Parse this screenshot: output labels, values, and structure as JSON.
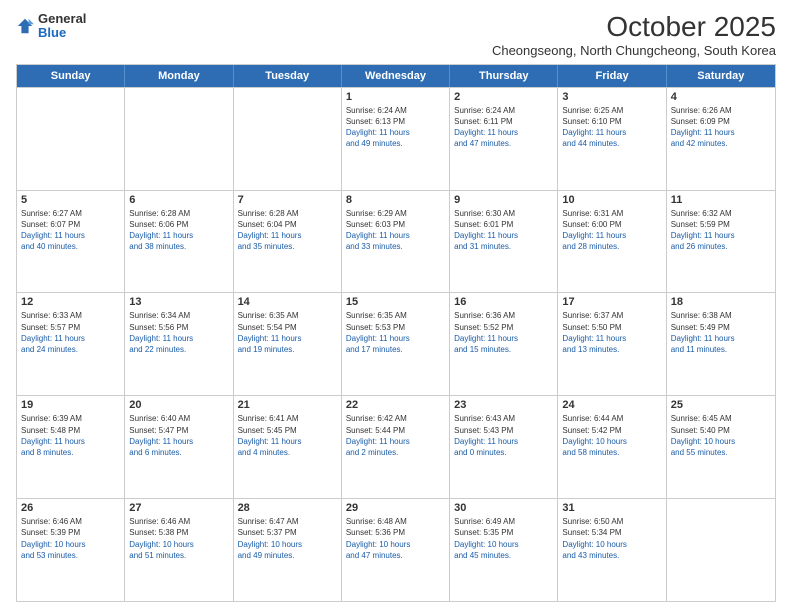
{
  "logo": {
    "general": "General",
    "blue": "Blue"
  },
  "header": {
    "month": "October 2025",
    "subtitle": "Cheongseong, North Chungcheong, South Korea"
  },
  "weekdays": [
    "Sunday",
    "Monday",
    "Tuesday",
    "Wednesday",
    "Thursday",
    "Friday",
    "Saturday"
  ],
  "weeks": [
    [
      {
        "day": "",
        "info": ""
      },
      {
        "day": "",
        "info": ""
      },
      {
        "day": "",
        "info": ""
      },
      {
        "day": "1",
        "info": "Sunrise: 6:24 AM\nSunset: 6:13 PM\nDaylight: 11 hours\nand 49 minutes."
      },
      {
        "day": "2",
        "info": "Sunrise: 6:24 AM\nSunset: 6:11 PM\nDaylight: 11 hours\nand 47 minutes."
      },
      {
        "day": "3",
        "info": "Sunrise: 6:25 AM\nSunset: 6:10 PM\nDaylight: 11 hours\nand 44 minutes."
      },
      {
        "day": "4",
        "info": "Sunrise: 6:26 AM\nSunset: 6:09 PM\nDaylight: 11 hours\nand 42 minutes."
      }
    ],
    [
      {
        "day": "5",
        "info": "Sunrise: 6:27 AM\nSunset: 6:07 PM\nDaylight: 11 hours\nand 40 minutes."
      },
      {
        "day": "6",
        "info": "Sunrise: 6:28 AM\nSunset: 6:06 PM\nDaylight: 11 hours\nand 38 minutes."
      },
      {
        "day": "7",
        "info": "Sunrise: 6:28 AM\nSunset: 6:04 PM\nDaylight: 11 hours\nand 35 minutes."
      },
      {
        "day": "8",
        "info": "Sunrise: 6:29 AM\nSunset: 6:03 PM\nDaylight: 11 hours\nand 33 minutes."
      },
      {
        "day": "9",
        "info": "Sunrise: 6:30 AM\nSunset: 6:01 PM\nDaylight: 11 hours\nand 31 minutes."
      },
      {
        "day": "10",
        "info": "Sunrise: 6:31 AM\nSunset: 6:00 PM\nDaylight: 11 hours\nand 28 minutes."
      },
      {
        "day": "11",
        "info": "Sunrise: 6:32 AM\nSunset: 5:59 PM\nDaylight: 11 hours\nand 26 minutes."
      }
    ],
    [
      {
        "day": "12",
        "info": "Sunrise: 6:33 AM\nSunset: 5:57 PM\nDaylight: 11 hours\nand 24 minutes."
      },
      {
        "day": "13",
        "info": "Sunrise: 6:34 AM\nSunset: 5:56 PM\nDaylight: 11 hours\nand 22 minutes."
      },
      {
        "day": "14",
        "info": "Sunrise: 6:35 AM\nSunset: 5:54 PM\nDaylight: 11 hours\nand 19 minutes."
      },
      {
        "day": "15",
        "info": "Sunrise: 6:35 AM\nSunset: 5:53 PM\nDaylight: 11 hours\nand 17 minutes."
      },
      {
        "day": "16",
        "info": "Sunrise: 6:36 AM\nSunset: 5:52 PM\nDaylight: 11 hours\nand 15 minutes."
      },
      {
        "day": "17",
        "info": "Sunrise: 6:37 AM\nSunset: 5:50 PM\nDaylight: 11 hours\nand 13 minutes."
      },
      {
        "day": "18",
        "info": "Sunrise: 6:38 AM\nSunset: 5:49 PM\nDaylight: 11 hours\nand 11 minutes."
      }
    ],
    [
      {
        "day": "19",
        "info": "Sunrise: 6:39 AM\nSunset: 5:48 PM\nDaylight: 11 hours\nand 8 minutes."
      },
      {
        "day": "20",
        "info": "Sunrise: 6:40 AM\nSunset: 5:47 PM\nDaylight: 11 hours\nand 6 minutes."
      },
      {
        "day": "21",
        "info": "Sunrise: 6:41 AM\nSunset: 5:45 PM\nDaylight: 11 hours\nand 4 minutes."
      },
      {
        "day": "22",
        "info": "Sunrise: 6:42 AM\nSunset: 5:44 PM\nDaylight: 11 hours\nand 2 minutes."
      },
      {
        "day": "23",
        "info": "Sunrise: 6:43 AM\nSunset: 5:43 PM\nDaylight: 11 hours\nand 0 minutes."
      },
      {
        "day": "24",
        "info": "Sunrise: 6:44 AM\nSunset: 5:42 PM\nDaylight: 10 hours\nand 58 minutes."
      },
      {
        "day": "25",
        "info": "Sunrise: 6:45 AM\nSunset: 5:40 PM\nDaylight: 10 hours\nand 55 minutes."
      }
    ],
    [
      {
        "day": "26",
        "info": "Sunrise: 6:46 AM\nSunset: 5:39 PM\nDaylight: 10 hours\nand 53 minutes."
      },
      {
        "day": "27",
        "info": "Sunrise: 6:46 AM\nSunset: 5:38 PM\nDaylight: 10 hours\nand 51 minutes."
      },
      {
        "day": "28",
        "info": "Sunrise: 6:47 AM\nSunset: 5:37 PM\nDaylight: 10 hours\nand 49 minutes."
      },
      {
        "day": "29",
        "info": "Sunrise: 6:48 AM\nSunset: 5:36 PM\nDaylight: 10 hours\nand 47 minutes."
      },
      {
        "day": "30",
        "info": "Sunrise: 6:49 AM\nSunset: 5:35 PM\nDaylight: 10 hours\nand 45 minutes."
      },
      {
        "day": "31",
        "info": "Sunrise: 6:50 AM\nSunset: 5:34 PM\nDaylight: 10 hours\nand 43 minutes."
      },
      {
        "day": "",
        "info": ""
      }
    ]
  ]
}
